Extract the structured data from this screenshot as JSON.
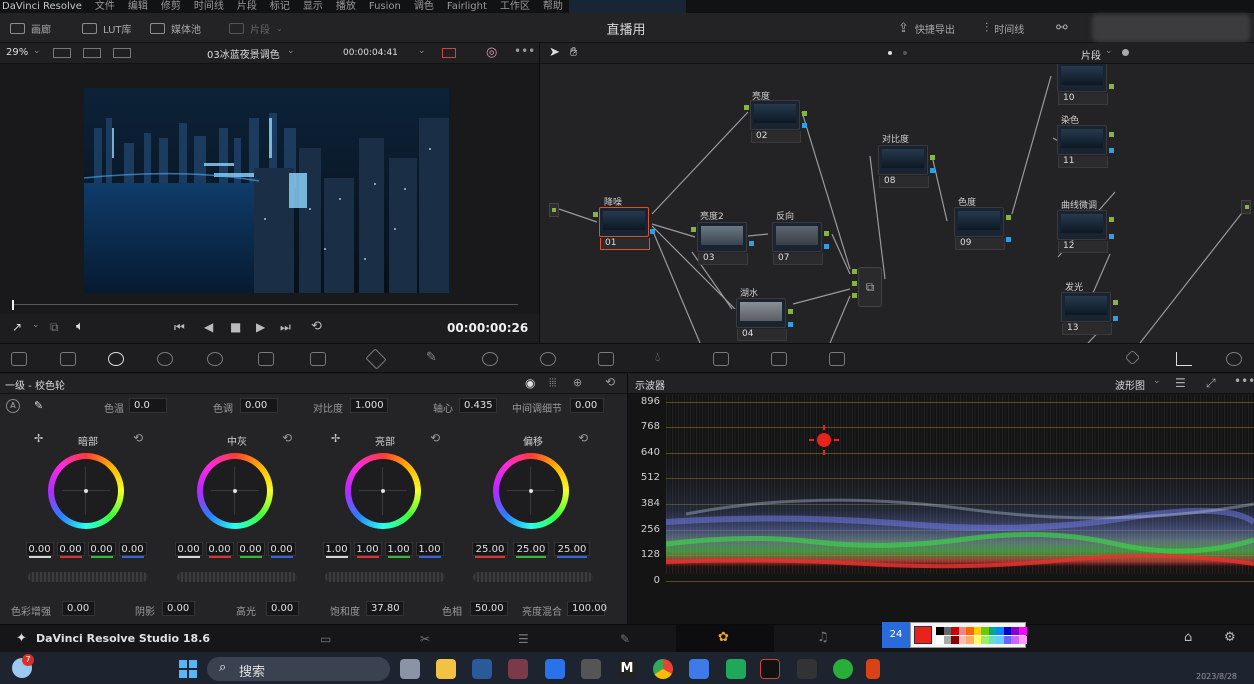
{
  "app_menu": [
    "DaVinci Resolve",
    "文件",
    "编辑",
    "修剪",
    "时间线",
    "片段",
    "标记",
    "显示",
    "播放",
    "Fusion",
    "调色",
    "Fairlight",
    "工作区",
    "帮助"
  ],
  "toolbar": {
    "gallery": "画廊",
    "lut_library": "LUT库",
    "media_pool": "媒体池",
    "clips": "片段",
    "project_title": "直播用",
    "quick_export": "快捷导出",
    "timeline": "时间线"
  },
  "viewer": {
    "zoom": "29%",
    "clip_name": "03冰蓝夜景调色",
    "source_timecode": "00:00:04:41",
    "timecode": "00:00:00:26"
  },
  "node_editor": {
    "mode": "片段",
    "nodes": [
      {
        "num": "01",
        "label": "降噪"
      },
      {
        "num": "02",
        "label": "亮度"
      },
      {
        "num": "03",
        "label": "亮度2"
      },
      {
        "num": "07",
        "label": "反向"
      },
      {
        "num": "04",
        "label": "湖水"
      },
      {
        "num": "08",
        "label": "对比度"
      },
      {
        "num": "09",
        "label": "色度"
      },
      {
        "num": "10",
        "label": ""
      },
      {
        "num": "11",
        "label": "染色"
      },
      {
        "num": "12",
        "label": "曲线微调"
      },
      {
        "num": "13",
        "label": "发光"
      }
    ]
  },
  "wheels": {
    "title": "一级 - 校色轮",
    "params_top": [
      {
        "label": "色温",
        "value": "0.0"
      },
      {
        "label": "色调",
        "value": "0.00"
      },
      {
        "label": "对比度",
        "value": "1.000"
      },
      {
        "label": "轴心",
        "value": "0.435"
      },
      {
        "label": "中间调细节",
        "value": "0.00"
      }
    ],
    "wheels": [
      {
        "name": "暗部",
        "values": [
          "0.00",
          "0.00",
          "0.00",
          "0.00"
        ]
      },
      {
        "name": "中灰",
        "values": [
          "0.00",
          "0.00",
          "0.00",
          "0.00"
        ]
      },
      {
        "name": "亮部",
        "values": [
          "1.00",
          "1.00",
          "1.00",
          "1.00"
        ]
      },
      {
        "name": "偏移",
        "values": [
          "25.00",
          "25.00",
          "25.00"
        ]
      }
    ],
    "params_bottom": [
      {
        "label": "色彩增强",
        "value": "0.00"
      },
      {
        "label": "阴影",
        "value": "0.00"
      },
      {
        "label": "高光",
        "value": "0.00"
      },
      {
        "label": "饱和度",
        "value": "37.80"
      },
      {
        "label": "色相",
        "value": "50.00"
      },
      {
        "label": "亮度混合",
        "value": "100.00"
      }
    ]
  },
  "scope": {
    "title": "示波器",
    "type": "波形图",
    "y_ticks": [
      "896",
      "768",
      "640",
      "512",
      "384",
      "256",
      "128",
      "0"
    ]
  },
  "footer": {
    "app_name": "DaVinci Resolve Studio 18.6"
  },
  "drawing_tool": {
    "size": "24"
  },
  "taskbar": {
    "search_placeholder": "搜索",
    "weather_badge": "7",
    "date_partial": "2023/8/28"
  },
  "colors": {
    "accent_blue": "#2ba0e8",
    "pin_green": "#86b341",
    "selected_node": "#d9532b",
    "drawing_red": "#e8231f"
  }
}
